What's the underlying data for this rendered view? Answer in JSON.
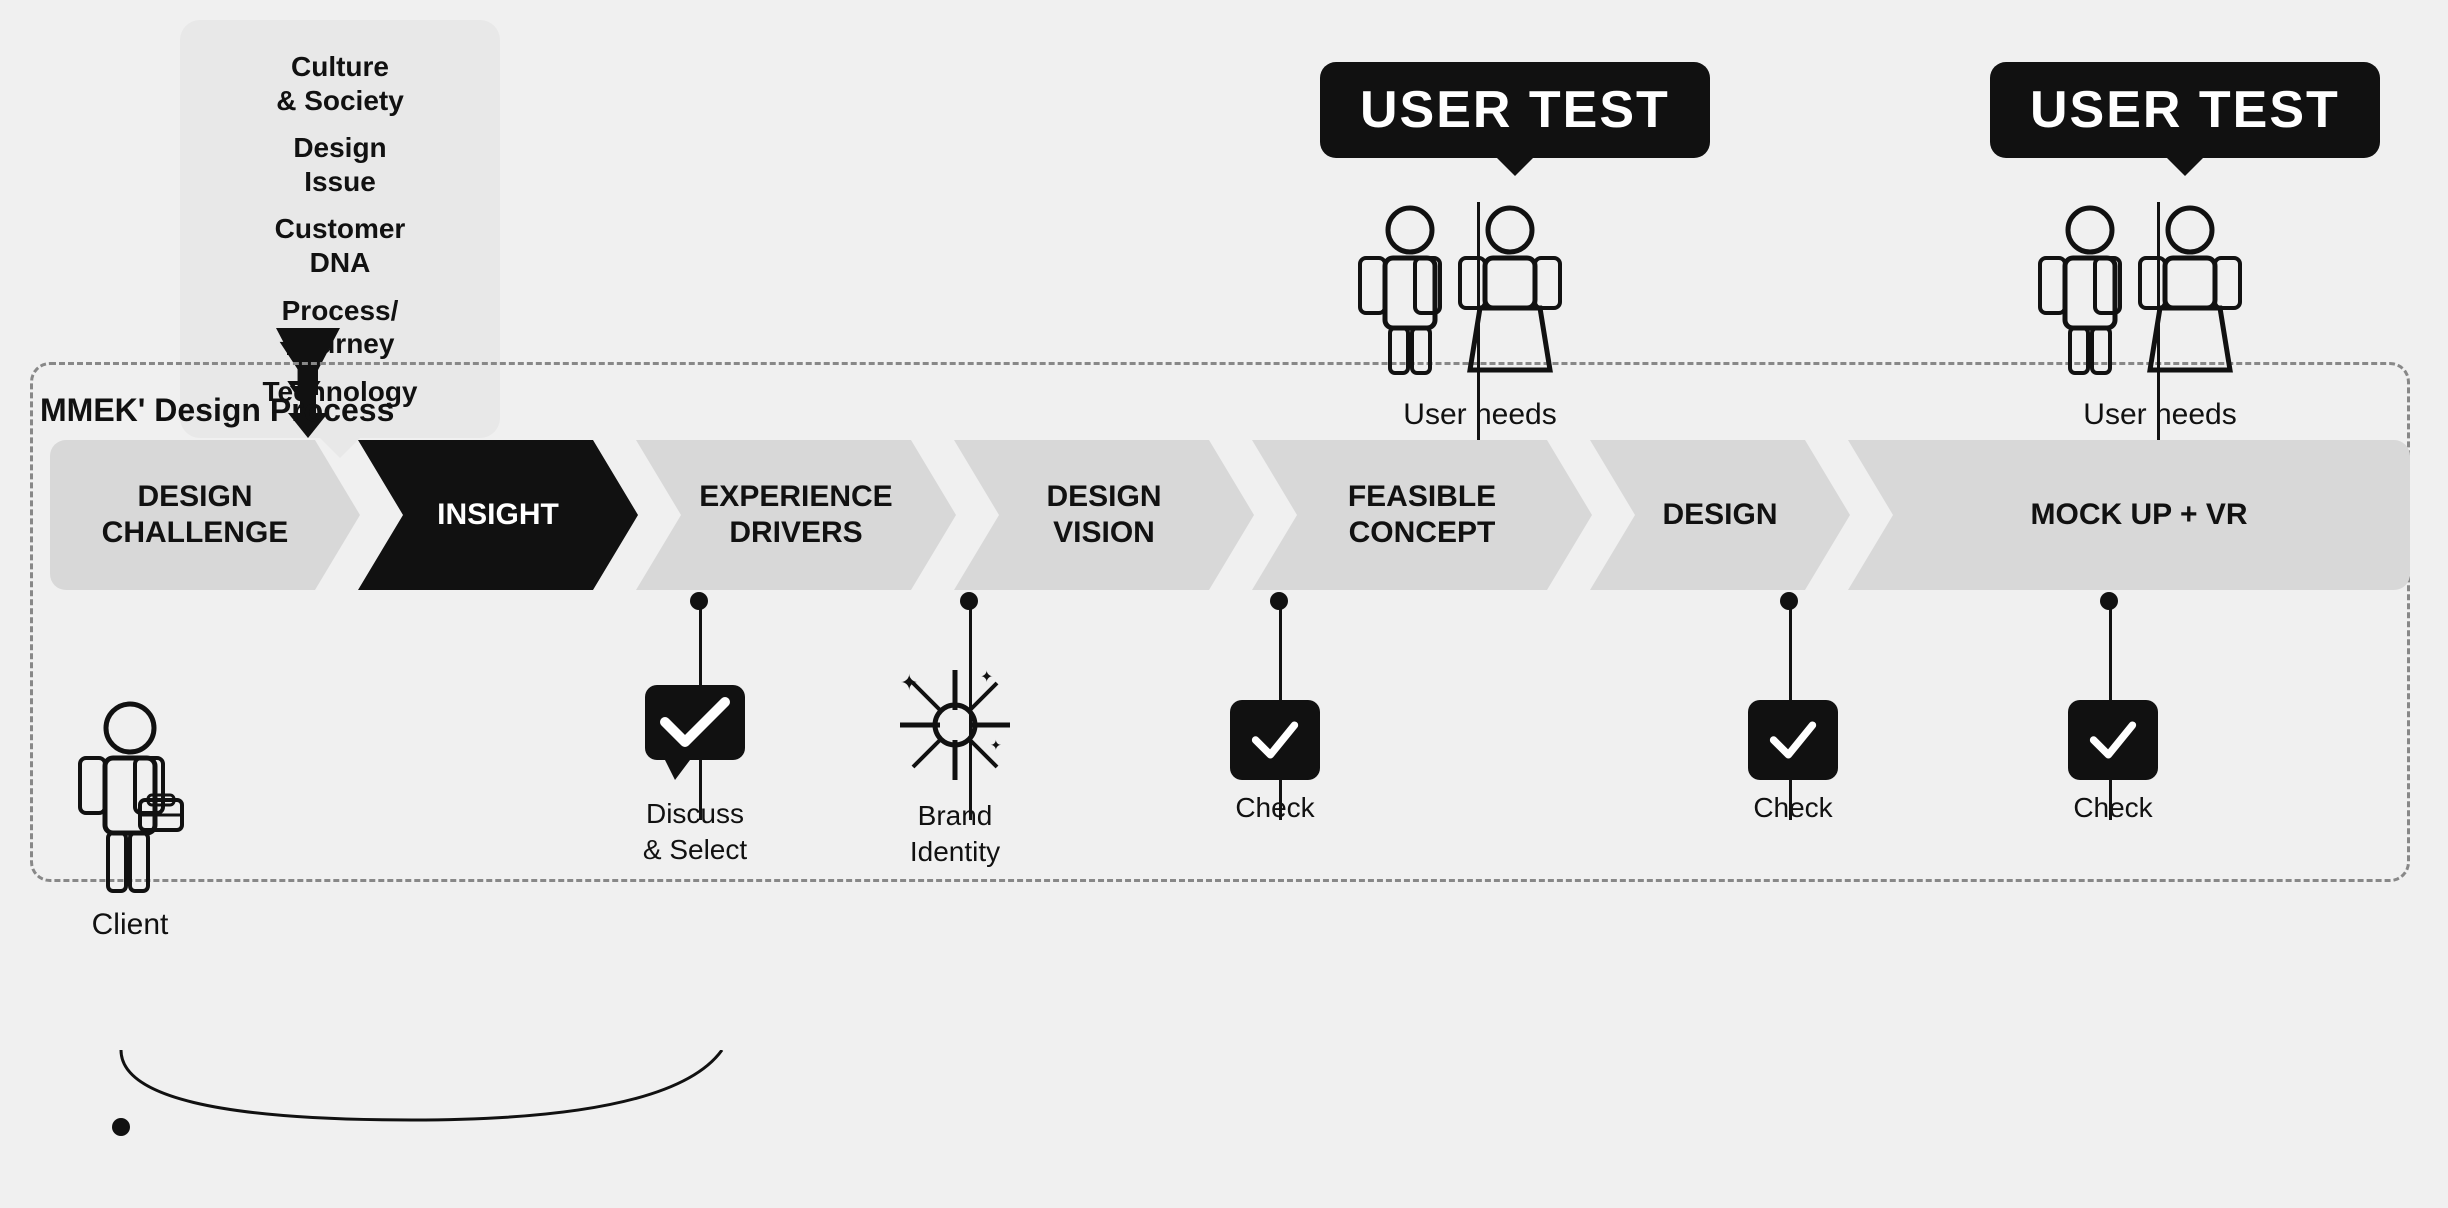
{
  "page": {
    "background": "#f0f0f0"
  },
  "input_bubble": {
    "items": [
      "Culture & Society",
      "Design Issue",
      "Customer DNA",
      "Process/ Journey",
      "Technology"
    ]
  },
  "user_test_labels": [
    "USER TEST",
    "USER TEST"
  ],
  "user_needs_labels": [
    "User needs",
    "User needs"
  ],
  "mmek_label": "MMEK' Design Process",
  "process_steps": [
    {
      "id": "design-challenge",
      "label": "DESIGN\nCHALLENGE",
      "style": "gray-first"
    },
    {
      "id": "insight",
      "label": "INSIGHT",
      "style": "black"
    },
    {
      "id": "experience-drivers",
      "label": "EXPERIENCE\nDRIVERS",
      "style": "gray"
    },
    {
      "id": "design-vision",
      "label": "DESIGN\nVISION",
      "style": "gray"
    },
    {
      "id": "feasible-concept",
      "label": "FEASIBLE\nCONCEPT",
      "style": "gray"
    },
    {
      "id": "design",
      "label": "DESIGN",
      "style": "gray"
    },
    {
      "id": "mock-up-vr",
      "label": "MOCK UP + VR",
      "style": "gray-last"
    }
  ],
  "bottom_items": [
    {
      "id": "client",
      "label": "Client",
      "type": "client"
    },
    {
      "id": "discuss-select",
      "label": "Discuss\n& Select",
      "type": "discuss"
    },
    {
      "id": "brand-identity",
      "label": "Brand\nIdentity",
      "type": "brand"
    },
    {
      "id": "check1",
      "label": "Check",
      "type": "check"
    },
    {
      "id": "check2",
      "label": "Check",
      "type": "check"
    },
    {
      "id": "check3",
      "label": "Check",
      "type": "check"
    }
  ]
}
